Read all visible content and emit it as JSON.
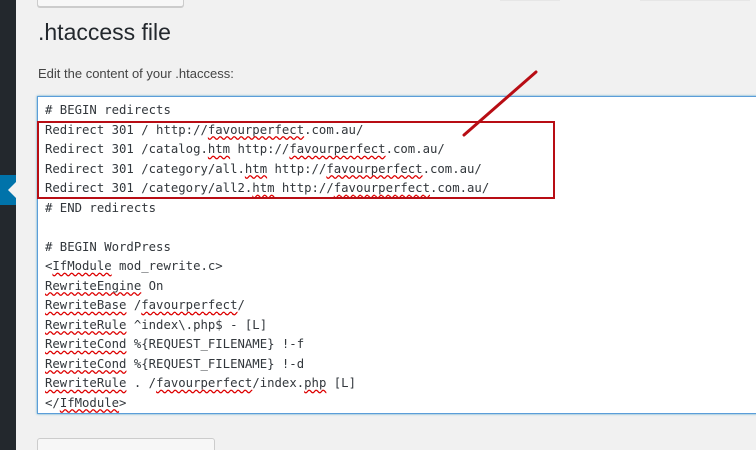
{
  "page": {
    "title": ".htaccess file",
    "description": "Edit the content of your .htaccess:"
  },
  "editor": {
    "lines": [
      {
        "parts": [
          {
            "t": "# BEGIN redirects"
          }
        ]
      },
      {
        "parts": [
          {
            "t": "Redirect 301 / http://"
          },
          {
            "t": "favourperfect",
            "spell": true
          },
          {
            "t": ".com.au/"
          }
        ]
      },
      {
        "parts": [
          {
            "t": "Redirect 301 /catalog."
          },
          {
            "t": "htm",
            "spell": true
          },
          {
            "t": " http://"
          },
          {
            "t": "favourperfect",
            "spell": true
          },
          {
            "t": ".com.au/"
          }
        ]
      },
      {
        "parts": [
          {
            "t": "Redirect 301 /category/all."
          },
          {
            "t": "htm",
            "spell": true
          },
          {
            "t": " http://"
          },
          {
            "t": "favourperfect",
            "spell": true
          },
          {
            "t": ".com.au/"
          }
        ]
      },
      {
        "parts": [
          {
            "t": "Redirect 301 /category/all2."
          },
          {
            "t": "htm",
            "spell": true
          },
          {
            "t": " http://"
          },
          {
            "t": "favourperfect",
            "spell": true
          },
          {
            "t": ".com.au/"
          }
        ]
      },
      {
        "parts": [
          {
            "t": "# END redirects"
          }
        ]
      },
      {
        "parts": [
          {
            "t": ""
          }
        ]
      },
      {
        "parts": [
          {
            "t": "# BEGIN WordPress"
          }
        ]
      },
      {
        "parts": [
          {
            "t": "<"
          },
          {
            "t": "IfModule",
            "spell": true
          },
          {
            "t": " mod_rewrite.c>"
          }
        ]
      },
      {
        "parts": [
          {
            "t": "RewriteEngine",
            "spell": true
          },
          {
            "t": " On"
          }
        ]
      },
      {
        "parts": [
          {
            "t": "RewriteBase",
            "spell": true
          },
          {
            "t": " /"
          },
          {
            "t": "favourperfect",
            "spell": true
          },
          {
            "t": "/"
          }
        ]
      },
      {
        "parts": [
          {
            "t": "RewriteRule",
            "spell": true
          },
          {
            "t": " ^index\\.php$ - [L]"
          }
        ]
      },
      {
        "parts": [
          {
            "t": "RewriteCond",
            "spell": true
          },
          {
            "t": " %{REQUEST_FILENAME} !-f"
          }
        ]
      },
      {
        "parts": [
          {
            "t": "RewriteCond",
            "spell": true
          },
          {
            "t": " %{REQUEST_FILENAME} !-d"
          }
        ]
      },
      {
        "parts": [
          {
            "t": "RewriteRule",
            "spell": true
          },
          {
            "t": " . /"
          },
          {
            "t": "favourperfect",
            "spell": true
          },
          {
            "t": "/index."
          },
          {
            "t": "php",
            "spell": true
          },
          {
            "t": " [L]"
          }
        ]
      },
      {
        "parts": [
          {
            "t": "</"
          },
          {
            "t": "IfModule",
            "spell": true
          },
          {
            "t": ">"
          }
        ]
      }
    ]
  },
  "colors": {
    "highlight": "#b80d14",
    "sidebar": "#23282d",
    "sidebar_active": "#0073aa",
    "editor_focus": "#5b9dd9"
  },
  "annotation": {
    "highlight_box": "red-rectangle",
    "pointer": "red-arrow-line"
  }
}
